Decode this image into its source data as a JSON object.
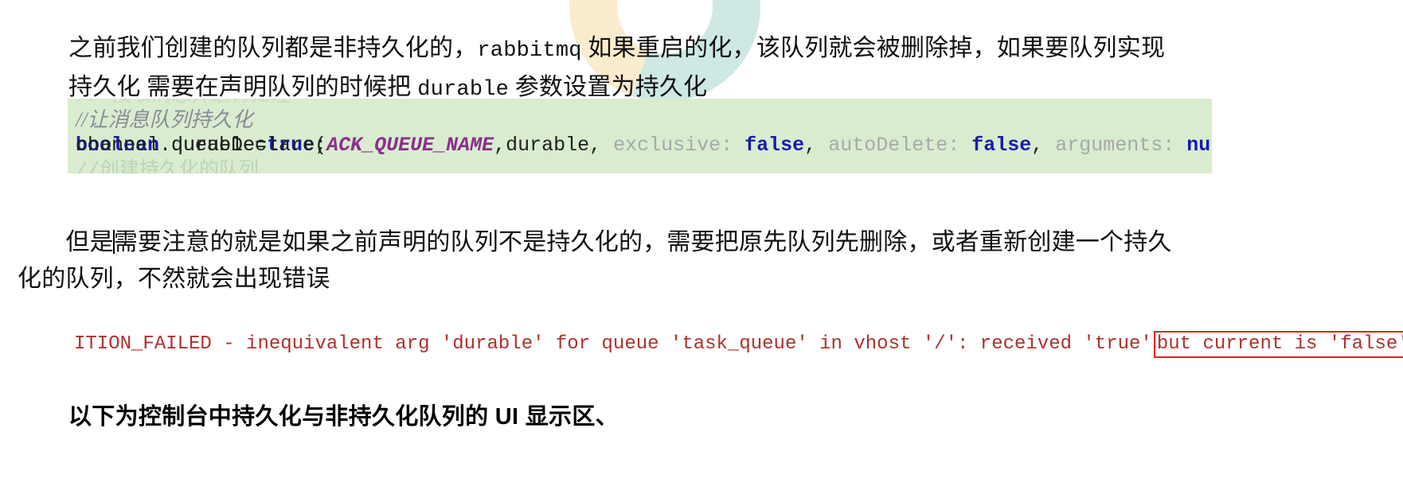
{
  "document": {
    "paragraphs": {
      "intro": "之前我们创建的队列都是非持久化的，rabbitmq 如果重启的化，该队列就会被删除掉，如果要队列实现持久化 需要在声明队列的时候把 durable 参数设置为持久化",
      "intro_line1_a": "之前我们创建的队列都是非持久化的，",
      "intro_line1_mono": "rabbitmq",
      "intro_line1_b": " 如果重启的化，该队列就会被删除掉，如果",
      "intro_line2_a": "要队列实现持久化 需要在声明队列的时候把 ",
      "intro_line2_mono": "durable",
      "intro_line2_b": " 参数设置为持久化",
      "note_a": "　　但是",
      "note_b": "需要注意的就是如果之前声明的队列不是持久化的，需要把原先队列先删除，或者重新创建一个持久化的队列，不然就会出现错误"
    },
    "code_block": {
      "background_color": "#d9ecd0",
      "language": "java",
      "lines": [
        {
          "id": "clipped-top",
          "tokens": [
            {
              "text": "// 接收消息并进行处理",
              "type": "clipped"
            }
          ]
        },
        {
          "id": "comment",
          "tokens": [
            {
              "text": "//让消息队列持久化",
              "type": "comment"
            }
          ]
        },
        {
          "id": "declare-durable",
          "tokens": [
            {
              "text": "boolean",
              "type": "keyword"
            },
            {
              "text": " durable=",
              "type": "plain"
            },
            {
              "text": "true",
              "type": "literal"
            },
            {
              "text": ";",
              "type": "plain"
            }
          ]
        },
        {
          "id": "queue-declare",
          "tokens": [
            {
              "text": "channel.queueDeclare(",
              "type": "plain"
            },
            {
              "text": "ACK_QUEUE_NAME",
              "type": "const"
            },
            {
              "text": ",durable, ",
              "type": "plain"
            },
            {
              "text": "exclusive: ",
              "type": "hint"
            },
            {
              "text": "false",
              "type": "literal"
            },
            {
              "text": ", ",
              "type": "plain"
            },
            {
              "text": "autoDelete: ",
              "type": "hint"
            },
            {
              "text": "false",
              "type": "literal"
            },
            {
              "text": ", ",
              "type": "plain"
            },
            {
              "text": "arguments: ",
              "type": "hint"
            },
            {
              "text": "null",
              "type": "literal"
            },
            {
              "text": ");",
              "type": "plain"
            }
          ]
        },
        {
          "id": "clipped-bottom",
          "tokens": [
            {
              "text": "//创建持久化的队列",
              "type": "clipped"
            }
          ]
        }
      ]
    },
    "error_line": {
      "color": "#b0302c",
      "box_color": "#ee1b1b",
      "text_before_box": "ITION_FAILED - inequivalent arg 'durable' for queue 'task_queue' in vhost '/': received 'true'",
      "boxed_text": "but current is 'false'",
      "text_after_box": ","
    },
    "closing_heading": "以下为控制台中持久化与非持久化队列的 UI 显示区、"
  }
}
